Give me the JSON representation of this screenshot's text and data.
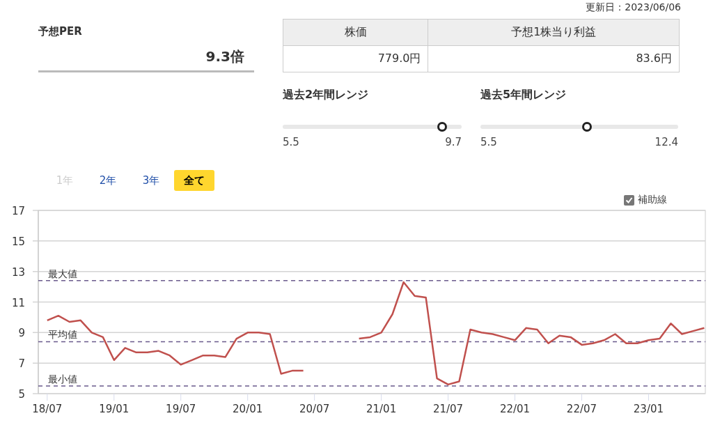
{
  "updated": "更新日：2023/06/06",
  "per": {
    "label": "予想PER",
    "value": "9.3倍"
  },
  "price_table": {
    "columns": [
      "株価",
      "予想1株当り利益"
    ],
    "row": [
      "779.0円",
      "83.6円"
    ]
  },
  "ranges": [
    {
      "title": "過去2年間レンジ",
      "min": "5.5",
      "max": "9.7",
      "level": 0.89
    },
    {
      "title": "過去5年間レンジ",
      "min": "5.5",
      "max": "12.4",
      "level": 0.54
    }
  ],
  "period_tabs": [
    {
      "label": "1年",
      "selected": false,
      "disabled": true
    },
    {
      "label": "2年",
      "selected": false,
      "disabled": false
    },
    {
      "label": "3年",
      "selected": false,
      "disabled": false
    },
    {
      "label": "全て",
      "selected": true,
      "disabled": false
    }
  ],
  "guide_lines": {
    "label": "補助線",
    "checked": true
  },
  "chart": {
    "chart_data": {
      "type": "line",
      "categories": [
        "18/07",
        null,
        null,
        null,
        null,
        null,
        "19/01",
        null,
        null,
        null,
        null,
        null,
        "19/07",
        null,
        null,
        null,
        null,
        null,
        "20/01",
        null,
        null,
        null,
        null,
        null,
        "20/07",
        null,
        null,
        null,
        null,
        null,
        "21/01",
        null,
        null,
        null,
        null,
        null,
        "21/07",
        null,
        null,
        null,
        null,
        null,
        "22/01",
        null,
        null,
        null,
        null,
        null,
        "22/07",
        null,
        null,
        null,
        null,
        null,
        "23/01",
        null,
        null,
        null,
        null,
        null
      ],
      "series": [
        {
          "color": "#c0504d",
          "values": [
            9.8,
            10.1,
            9.7,
            9.8,
            9.0,
            8.7,
            7.2,
            8.0,
            7.7,
            7.7,
            7.8,
            7.5,
            6.9,
            7.2,
            7.5,
            7.5,
            7.4,
            8.6,
            9.0,
            9.0,
            8.9,
            6.3,
            6.5,
            6.5,
            null,
            null,
            null,
            null,
            8.6,
            8.7,
            9.0,
            10.2,
            12.3,
            11.4,
            11.3,
            6.0,
            5.6,
            5.8,
            9.2,
            9.0,
            8.9,
            8.7,
            8.5,
            9.3,
            9.2,
            8.3,
            8.8,
            8.7,
            8.2,
            8.3,
            8.5,
            8.9,
            8.3,
            8.3,
            8.5,
            8.6,
            9.6,
            8.9,
            9.1,
            9.3
          ]
        }
      ],
      "ylim": [
        5,
        17
      ],
      "yticks": [
        5,
        7,
        9,
        11,
        13,
        15,
        17
      ],
      "grid": true,
      "ref_lines": [
        {
          "axis": "y",
          "value": 12.4,
          "label": "最大値"
        },
        {
          "axis": "y",
          "value": 8.4,
          "label": "平均値"
        },
        {
          "axis": "y",
          "value": 5.5,
          "label": "最小値"
        }
      ]
    }
  }
}
